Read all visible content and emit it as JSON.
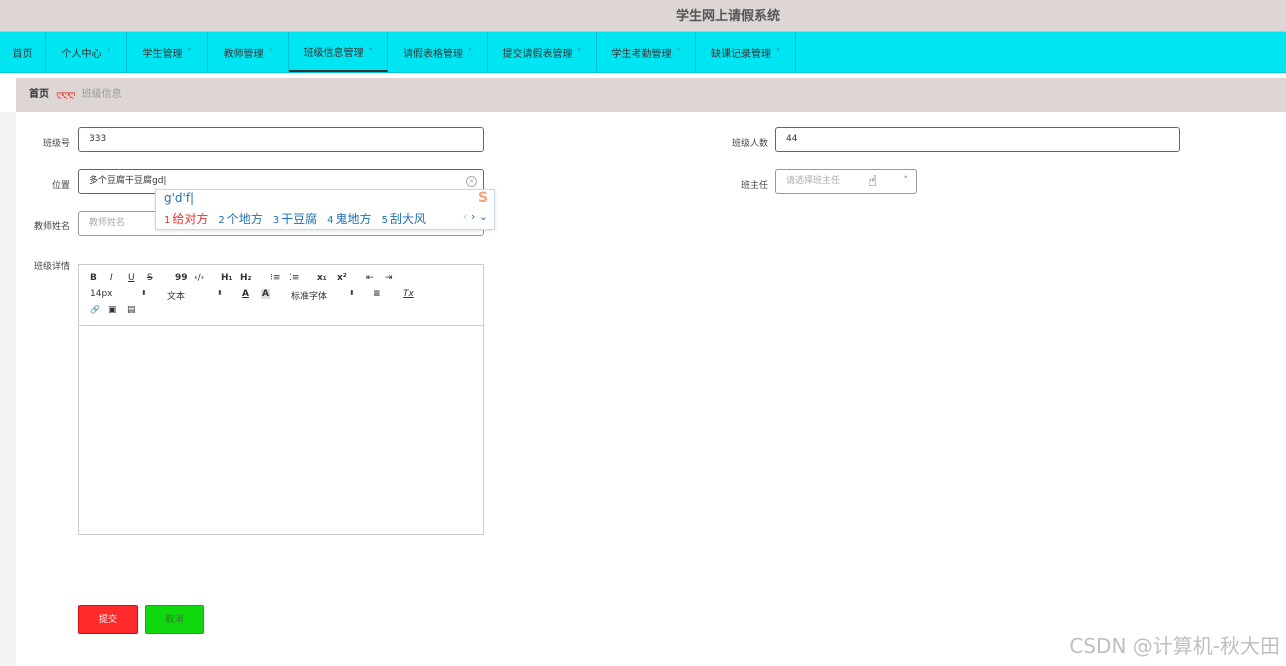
{
  "app": {
    "title": "学生网上请假系统"
  },
  "nav": {
    "items": [
      {
        "label": "首页",
        "has_dropdown": false
      },
      {
        "label": "个人中心",
        "has_dropdown": true
      },
      {
        "label": "学生管理",
        "has_dropdown": true
      },
      {
        "label": "教师管理",
        "has_dropdown": true
      },
      {
        "label": "班级信息管理",
        "has_dropdown": true,
        "active": true
      },
      {
        "label": "请假表格管理",
        "has_dropdown": true
      },
      {
        "label": "提交请假表管理",
        "has_dropdown": true
      },
      {
        "label": "学生考勤管理",
        "has_dropdown": true
      },
      {
        "label": "缺课记录管理",
        "has_dropdown": true
      }
    ],
    "chevron": "˅"
  },
  "breadcrumb": {
    "home": "首页",
    "separator": "ღღღ",
    "current": "班级信息"
  },
  "form": {
    "class_no": {
      "label": "班级号",
      "value": "333"
    },
    "class_size": {
      "label": "班级人数",
      "value": "44"
    },
    "location": {
      "label": "位置",
      "value": "多个豆腐干豆腐gd|"
    },
    "head_teacher": {
      "label": "班主任",
      "placeholder": "请选择班主任"
    },
    "teacher_name": {
      "label": "教师姓名",
      "placeholder": "教师姓名"
    },
    "class_detail": {
      "label": "班级详情"
    }
  },
  "ime": {
    "composition": "g'd'f|",
    "candidates": [
      {
        "num": "1",
        "text": "给对方"
      },
      {
        "num": "2",
        "text": "个地方"
      },
      {
        "num": "3",
        "text": "干豆腐"
      },
      {
        "num": "4",
        "text": "鬼地方"
      },
      {
        "num": "5",
        "text": "刮大风"
      }
    ],
    "prev": "‹",
    "next": "›",
    "more": "⌄",
    "logo": "S"
  },
  "editor": {
    "toolbar": {
      "bold": "B",
      "italic": "I",
      "underline": "U",
      "strike": "S",
      "quote": "99",
      "code": "‹/›",
      "h1": "H₁",
      "h2": "H₂",
      "ol": "⁝≡",
      "ul": "⁚≡",
      "sub": "x₁",
      "sup": "x²",
      "indent_out": "⇤",
      "indent_in": "⇥",
      "size": "14px",
      "header": "文本",
      "color": "A",
      "bg": "A",
      "font": "标准字体",
      "align": "≡",
      "clean": "Tx",
      "link": "🔗",
      "image": "▣",
      "video": "▤",
      "select_arrow": "⬍"
    }
  },
  "buttons": {
    "submit": "提交",
    "cancel": "取消"
  },
  "watermark": "CSDN @计算机-秋大田",
  "colors": {
    "nav_bg": "#00e5f2",
    "title_bg": "#ddd6d4",
    "submit_bg": "#ff2a2a",
    "cancel_bg": "#0fd80f"
  }
}
